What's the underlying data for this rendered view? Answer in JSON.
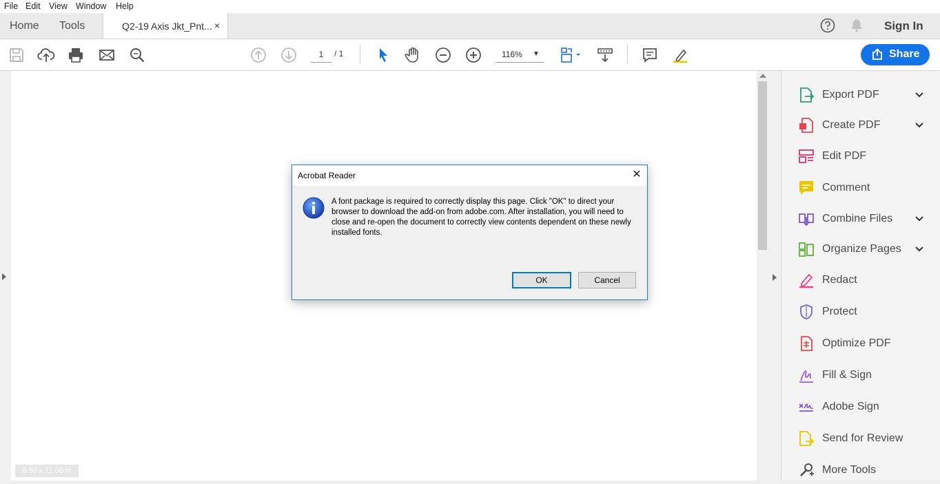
{
  "menu": [
    "File",
    "Edit",
    "View",
    "Window",
    "Help"
  ],
  "tabs": {
    "home": "Home",
    "tools": "Tools",
    "document": "Q2-19 Axis Jkt_Pnt...",
    "close": "×"
  },
  "header": {
    "sign_in": "Sign In"
  },
  "toolbar": {
    "page_current": "1",
    "page_total": "/ 1",
    "zoom": "116%",
    "share_label": "Share"
  },
  "document": {
    "page_size": "8.50 x 11.00 in"
  },
  "side_panel": {
    "tools": [
      {
        "label": "Export PDF",
        "icon": "export-pdf-icon",
        "expandable": true,
        "color": "#2d9d78"
      },
      {
        "label": "Create PDF",
        "icon": "create-pdf-icon",
        "expandable": true,
        "color": "#e34850"
      },
      {
        "label": "Edit PDF",
        "icon": "edit-pdf-icon",
        "expandable": false,
        "color": "#d1376b"
      },
      {
        "label": "Comment",
        "icon": "comment-icon",
        "expandable": false,
        "color": "#e8c600"
      },
      {
        "label": "Combine Files",
        "icon": "combine-files-icon",
        "expandable": true,
        "color": "#7e57d2"
      },
      {
        "label": "Organize Pages",
        "icon": "organize-pages-icon",
        "expandable": true,
        "color": "#5fb336"
      },
      {
        "label": "Redact",
        "icon": "redact-icon",
        "expandable": false,
        "color": "#e34c8d"
      },
      {
        "label": "Protect",
        "icon": "protect-icon",
        "expandable": false,
        "color": "#7268d8"
      },
      {
        "label": "Optimize PDF",
        "icon": "optimize-pdf-icon",
        "expandable": false,
        "color": "#e34850"
      },
      {
        "label": "Fill & Sign",
        "icon": "fill-sign-icon",
        "expandable": false,
        "color": "#9c5ad8"
      },
      {
        "label": "Adobe Sign",
        "icon": "adobe-sign-icon",
        "expandable": false,
        "color": "#7e57d2"
      },
      {
        "label": "Send for Review",
        "icon": "send-for-review-icon",
        "expandable": false,
        "color": "#e8c600"
      },
      {
        "label": "More Tools",
        "icon": "more-tools-icon",
        "expandable": false,
        "color": "#505050"
      }
    ]
  },
  "dialog": {
    "title": "Acrobat Reader",
    "close": "✕",
    "message": "A font package is required to correctly display this page. Click \"OK\" to direct your browser to download the add-on from adobe.com. After installation, you will need to close and re-open the document to correctly view contents dependent on these newly installed fonts.",
    "ok_label": "OK",
    "cancel_label": "Cancel"
  },
  "colors": {
    "accent": "#1473e6",
    "dialog_border": "#1683d8",
    "select_tool": "#1473e6"
  }
}
